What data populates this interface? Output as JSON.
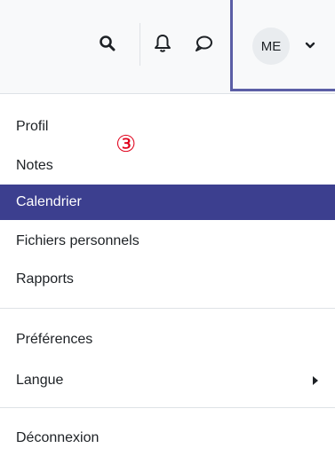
{
  "navbar": {
    "icons": {
      "search": "search-icon",
      "bell": "bell-icon",
      "chat": "chat-icon",
      "caret": "chevron-down-icon"
    },
    "avatar_initials": "ME"
  },
  "annotation": {
    "marker": "③"
  },
  "dropdown": {
    "items": [
      {
        "label": "Profil"
      },
      {
        "label": "Notes"
      },
      {
        "label": "Calendrier",
        "active": true
      },
      {
        "label": "Fichiers personnels"
      },
      {
        "label": "Rapports"
      },
      {
        "label": "Préférences"
      },
      {
        "label": "Langue",
        "submenu": true
      },
      {
        "label": "Déconnexion"
      }
    ]
  },
  "colors": {
    "active_bg": "#3c3f8f",
    "focus_border": "#5b5ea6",
    "marker": "#e0001b"
  }
}
